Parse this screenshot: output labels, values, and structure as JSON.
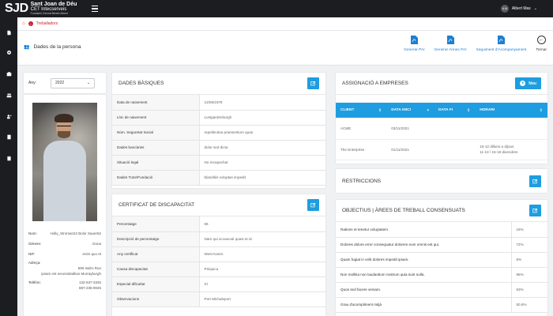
{
  "brand": {
    "mark": "SJD",
    "line1": "Sant Joan de Déu",
    "line2": "CET Intecserveis",
    "line3": "Fundació Germà Benito Menni"
  },
  "user": {
    "initials": "A.M",
    "name": "Albert Mas"
  },
  "breadcrumb": {
    "current": "Treballadors"
  },
  "page": {
    "title": "Dades de la persona"
  },
  "actions": [
    {
      "label": "Generar PAI"
    },
    {
      "label": "Generar Annex PAI"
    },
    {
      "label": "Seguiment d'Acompanyament"
    },
    {
      "label": "Tornar"
    }
  ],
  "year": {
    "label": "Any:",
    "value": "2022"
  },
  "person": {
    "nom_label": "Nom:",
    "nom": "Holly_Stroman22 Bolor Sauer62",
    "genere_label": "Gènere:",
    "genere": "Dona",
    "nif_label": "NIF:",
    "nif": "enim quo et",
    "adreca_label": "Adreça:",
    "adreca_1": "590 Isidro Run",
    "adreca_2": "ipsam est necessitatibus Murrayburgh",
    "telefon_label": "Telèfon:",
    "telefon_1": "132-537-3345",
    "telefon_2": "887-235-9025"
  },
  "dades_basiques": {
    "title": "DADES BÀSIQUES",
    "rows": [
      {
        "k": "Data de naixement",
        "v": "13/06/1978"
      },
      {
        "k": "Lloc de naixement",
        "v": "Lustgardenburgh"
      },
      {
        "k": "Núm. Seguretat Social",
        "v": "repellendus praesentium quas"
      },
      {
        "k": "Dades bancàries",
        "v": "dolor sed dicta"
      },
      {
        "k": "Situació legal",
        "v": "No recapachat"
      },
      {
        "k": "Dades Tutor/Fundació",
        "v": "blanditiis voluptas impedit"
      }
    ]
  },
  "certificat": {
    "title": "CERTIFICAT DE DISCAPACITAT",
    "rows": [
      {
        "k": "Percentatge",
        "v": "66"
      },
      {
        "k": "Descripció de percentatge",
        "v": "Nam qui occaecati quasi et id."
      },
      {
        "k": "Any certificat",
        "v": "West Karen"
      },
      {
        "k": "Causa discapacitat",
        "v": "Psíquica"
      },
      {
        "k": "Especial dificultat",
        "v": "Sí"
      },
      {
        "k": "Observacions",
        "v": "Port Michaleport"
      }
    ]
  },
  "assignacio": {
    "title": "ASSIGNACIÓ A EMPRESES",
    "new_label": "Nou",
    "columns": [
      "CLIENT",
      "DATA INICI",
      "DATA FI",
      "HORARI"
    ],
    "rows": [
      {
        "client": "ACME",
        "inici": "03/11/2021",
        "fi": "",
        "horari_1": "",
        "horari_2": ""
      },
      {
        "client": "The Enterprise",
        "inici": "01/11/2021",
        "fi": "",
        "horari_1": "10-12 dilluns a dijous",
        "horari_2": "11-13 / 15-18 divendres"
      }
    ]
  },
  "restriccions": {
    "title": "RESTRICCIONS"
  },
  "objectius": {
    "title": "OBJECTIUS | ÀREES DE TREBALL CONSENSUATS",
    "rows": [
      {
        "k": "Rations et tenetur voluptatem.",
        "v": "16%"
      },
      {
        "k": "Dolores dolore error consequatur dolorem eum omnis est qui.",
        "v": "72%"
      },
      {
        "k": "Quam fugiat in velit dolores impedit ipsam.",
        "v": "6%"
      },
      {
        "k": "Non mollitia non laudantium nostrum quia sunt nulla.",
        "v": "96%"
      },
      {
        "k": "Quos sed facere veniam.",
        "v": "63%"
      },
      {
        "k": "Grau d'acompliment mitjà",
        "v": "50.6%"
      }
    ]
  },
  "colors": {
    "accent": "#1e9de0",
    "brand_red": "#d52030",
    "dark": "#1c1d21"
  }
}
